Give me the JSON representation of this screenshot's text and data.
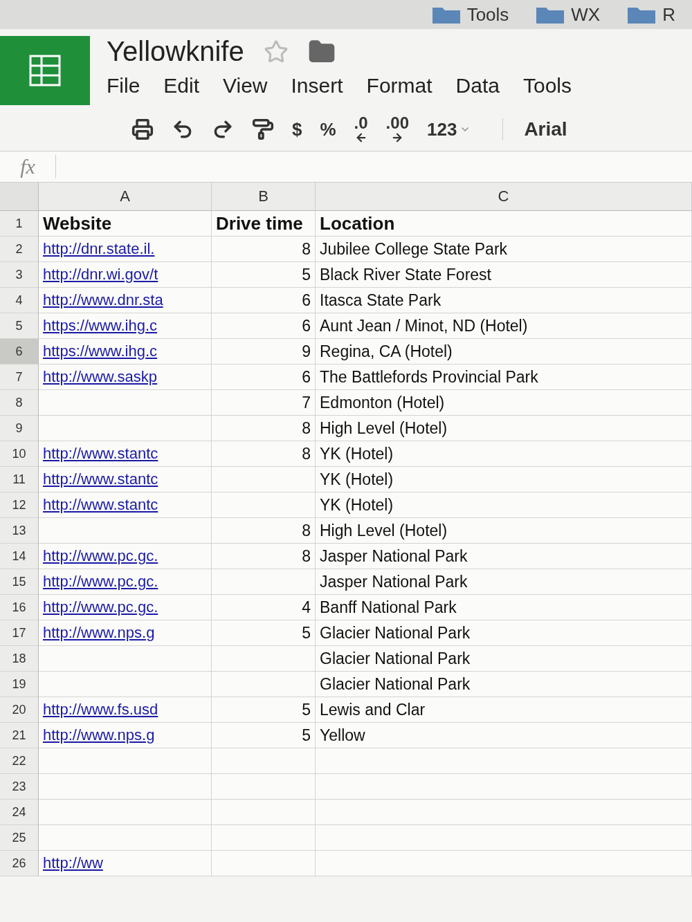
{
  "bookmarks": [
    "Tools",
    "WX",
    "R"
  ],
  "document": {
    "title": "Yellowknife",
    "starred": false
  },
  "menu": [
    "File",
    "Edit",
    "View",
    "Insert",
    "Format",
    "Data",
    "Tools"
  ],
  "toolbar": [
    {
      "kind": "print"
    },
    {
      "kind": "undo"
    },
    {
      "kind": "redo"
    },
    {
      "kind": "paint"
    },
    {
      "kind": "text",
      "label": "$"
    },
    {
      "kind": "text",
      "label": "%"
    },
    {
      "kind": "decimal_decrease",
      "label": ".0"
    },
    {
      "kind": "decimal_increase",
      "label": ".00"
    },
    {
      "kind": "dropdown",
      "label": "123"
    },
    {
      "kind": "font",
      "label": "Arial"
    }
  ],
  "formula_bar": {
    "label": "fx"
  },
  "columns": [
    "A",
    "B",
    "C"
  ],
  "header_row": {
    "number": "1",
    "website": "Website",
    "drive_time": "Drive time",
    "location": "Location",
    "selected": false
  },
  "rows": [
    {
      "number": "2",
      "website": "http://dnr.state.il.",
      "drive_time": "8",
      "location": "Jubilee College State Park",
      "selected": false
    },
    {
      "number": "3",
      "website": "http://dnr.wi.gov/t",
      "drive_time": "5",
      "location": "Black River State Forest",
      "selected": false
    },
    {
      "number": "4",
      "website": "http://www.dnr.sta",
      "drive_time": "6",
      "location": "Itasca State Park",
      "selected": false
    },
    {
      "number": "5",
      "website": "https://www.ihg.c",
      "drive_time": "6",
      "location": "Aunt Jean / Minot, ND (Hotel)",
      "selected": false
    },
    {
      "number": "6",
      "website": "https://www.ihg.c",
      "drive_time": "9",
      "location": "Regina, CA (Hotel)",
      "selected": true
    },
    {
      "number": "7",
      "website": "http://www.saskp",
      "drive_time": "6",
      "location": "The Battlefords Provincial Park",
      "selected": false
    },
    {
      "number": "8",
      "website": "",
      "drive_time": "7",
      "location": "Edmonton (Hotel)",
      "selected": false
    },
    {
      "number": "9",
      "website": "",
      "drive_time": "8",
      "location": "High Level (Hotel)",
      "selected": false
    },
    {
      "number": "10",
      "website": "http://www.stantc",
      "drive_time": "8",
      "location": "YK (Hotel)",
      "selected": false
    },
    {
      "number": "11",
      "website": "http://www.stantc",
      "drive_time": "",
      "location": "YK (Hotel)",
      "selected": false
    },
    {
      "number": "12",
      "website": "http://www.stantc",
      "drive_time": "",
      "location": "YK (Hotel)",
      "selected": false
    },
    {
      "number": "13",
      "website": "",
      "drive_time": "8",
      "location": "High Level (Hotel)",
      "selected": false
    },
    {
      "number": "14",
      "website": "http://www.pc.gc.",
      "drive_time": "8",
      "location": "Jasper National Park",
      "selected": false
    },
    {
      "number": "15",
      "website": "http://www.pc.gc.",
      "drive_time": "",
      "location": "Jasper National Park",
      "selected": false
    },
    {
      "number": "16",
      "website": "http://www.pc.gc.",
      "drive_time": "4",
      "location": "Banff National Park",
      "selected": false
    },
    {
      "number": "17",
      "website": "http://www.nps.g",
      "drive_time": "5",
      "location": "Glacier National Park",
      "selected": false
    },
    {
      "number": "18",
      "website": "",
      "drive_time": "",
      "location": "Glacier National Park",
      "selected": false
    },
    {
      "number": "19",
      "website": "",
      "drive_time": "",
      "location": "Glacier National Park",
      "selected": false
    },
    {
      "number": "20",
      "website": "http://www.fs.usd",
      "drive_time": "5",
      "location": "Lewis and Clar",
      "selected": false
    },
    {
      "number": "21",
      "website": "http://www.nps.g",
      "drive_time": "5",
      "location": "Yellow",
      "selected": false
    },
    {
      "number": "22",
      "website": "",
      "drive_time": "",
      "location": "",
      "selected": false
    },
    {
      "number": "23",
      "website": "",
      "drive_time": "",
      "location": "",
      "selected": false
    },
    {
      "number": "24",
      "website": "",
      "drive_time": "",
      "location": "",
      "selected": false
    },
    {
      "number": "25",
      "website": "",
      "drive_time": "",
      "location": "",
      "selected": false
    },
    {
      "number": "26",
      "website": "http://ww",
      "drive_time": "",
      "location": "",
      "selected": false
    }
  ]
}
